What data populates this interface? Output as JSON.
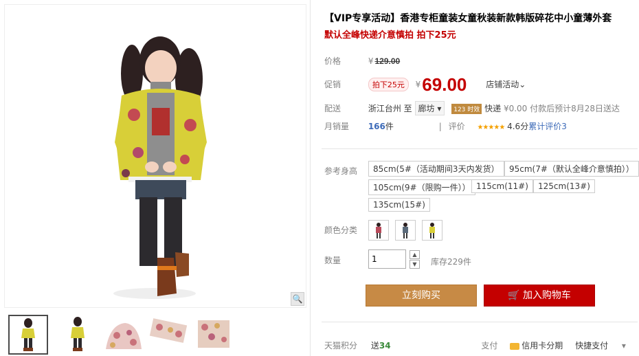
{
  "product": {
    "title": "【VIP专享活动】香港专柜童装女童秋装新款韩版碎花中小童薄外套",
    "subtitle": "默认全峰快递介意慎拍 拍下25元"
  },
  "pricing": {
    "price_label": "价格",
    "currency": "¥",
    "original_price": "129.00",
    "promo_label": "促销",
    "promo_tag": "拍下25元",
    "current_price": "69.00",
    "shop_promo": "店铺活动"
  },
  "shipping": {
    "label": "配送",
    "from": "浙江台州",
    "to_word": "至",
    "destination": "廊坊",
    "badge": "123 时效",
    "courier": "快递",
    "fee": "¥0.00",
    "eta": "付款后预计8月28日送达"
  },
  "sales": {
    "label": "月销量",
    "count": "166",
    "unit": "件",
    "rating_label": "评价",
    "stars": "★★★★★",
    "score": "4.6分",
    "review_text": "累计评价",
    "review_count": "3"
  },
  "sizes": {
    "label": "参考身高",
    "options": [
      "85cm(5#（活动期间3天内发货）",
      "95cm(7#（默认全峰介意慎拍））",
      "105cm(9#（限购一件））",
      "115cm(11#)",
      "125cm(13#)",
      "135cm(15#)"
    ]
  },
  "colors": {
    "label": "颜色分类"
  },
  "quantity": {
    "label": "数量",
    "value": "1",
    "stock": "库存229件"
  },
  "actions": {
    "buy_now": "立刻购买",
    "add_to_cart": "加入购物车"
  },
  "footer": {
    "points_label": "天猫积分",
    "points_prefix": "送",
    "points_value": "34",
    "pay_label": "支付",
    "credit": "信用卡分期",
    "quick_pay": "快捷支付"
  },
  "icons": {
    "zoom": "magnifier-icon",
    "cart": "cart-icon"
  }
}
